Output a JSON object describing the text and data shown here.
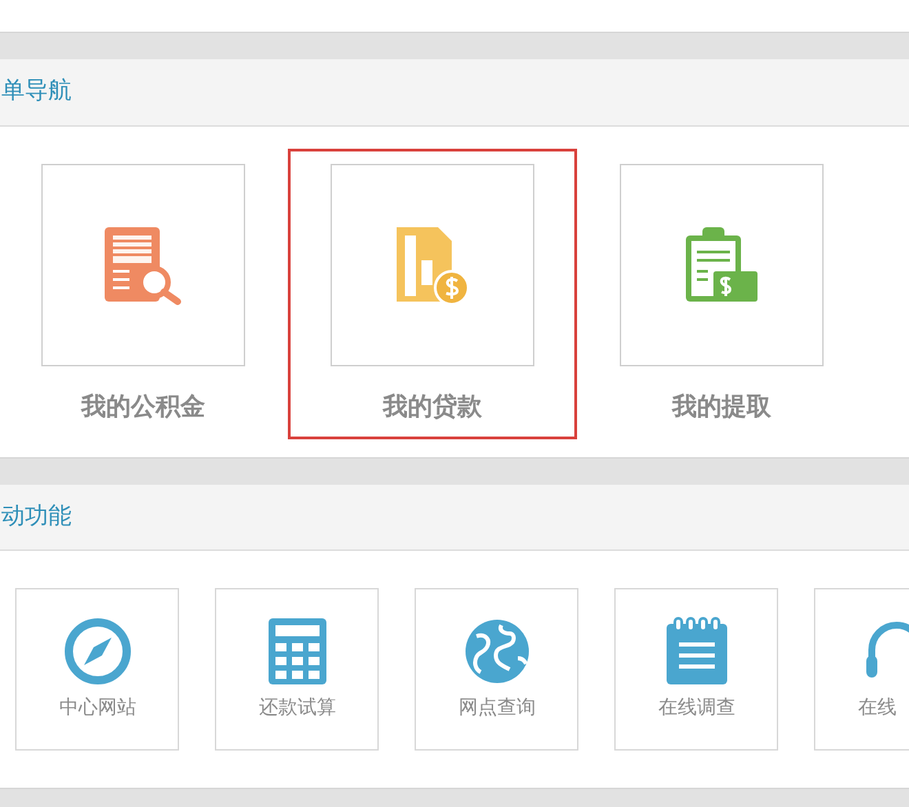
{
  "quick_nav": {
    "title": "单导航",
    "items": [
      {
        "label": "我的公积金",
        "highlighted": false
      },
      {
        "label": "我的贷款",
        "highlighted": true
      },
      {
        "label": "我的提取",
        "highlighted": false
      }
    ]
  },
  "functions": {
    "title": "动功能",
    "items": [
      {
        "label": "中心网站"
      },
      {
        "label": "还款试算"
      },
      {
        "label": "网点查询"
      },
      {
        "label": "在线调查"
      },
      {
        "label": "在线"
      }
    ]
  }
}
